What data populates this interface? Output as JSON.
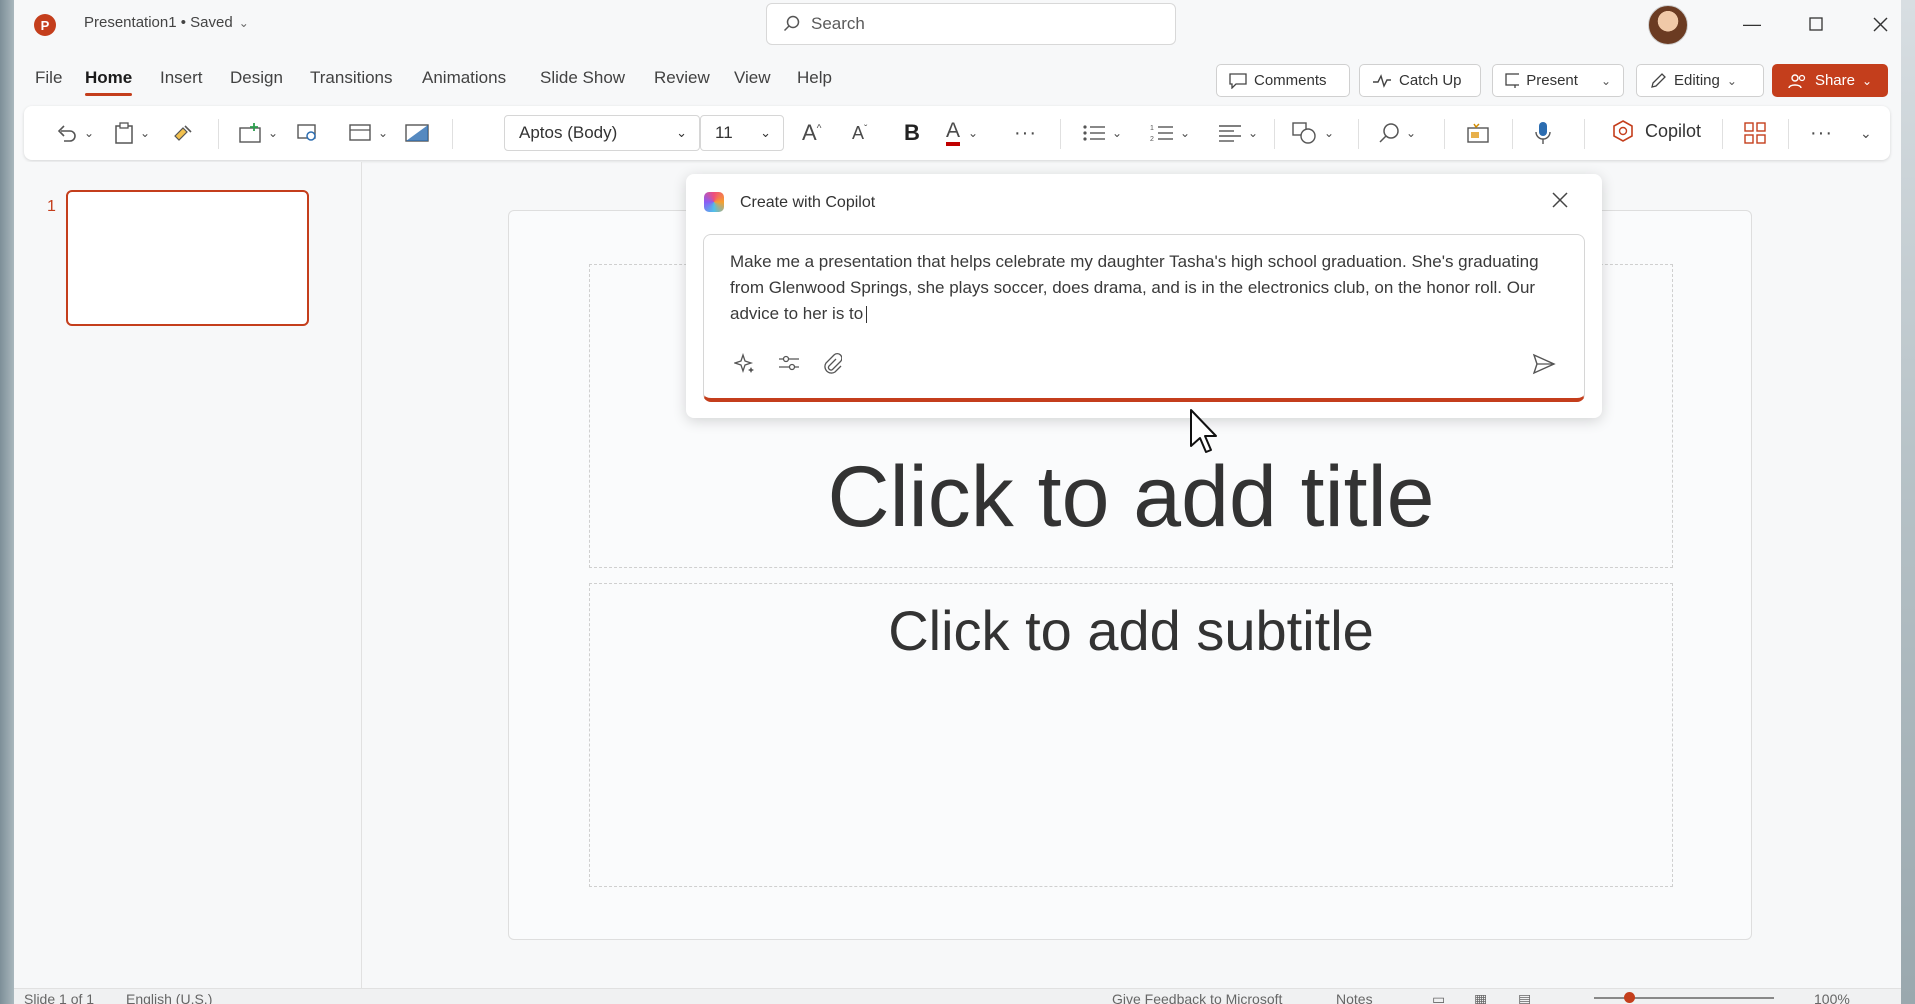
{
  "titlebar": {
    "app_icon": "P",
    "doc_title": "Presentation1 • Saved",
    "search_placeholder": "Search"
  },
  "menu": {
    "tabs": [
      "File",
      "Home",
      "Insert",
      "Design",
      "Transitions",
      "Animations",
      "Slide Show",
      "Review",
      "View",
      "Help"
    ],
    "active_tab": "Home",
    "comments": "Comments",
    "catch_up": "Catch Up",
    "present": "Present",
    "editing": "Editing",
    "share": "Share"
  },
  "ribbon": {
    "font_name": "Aptos (Body)",
    "font_size": "11",
    "bold": "B",
    "copilot_label": "Copilot",
    "more": "···"
  },
  "thumbnails": {
    "slide_number": "1"
  },
  "slide": {
    "title_placeholder": "Click to add title",
    "subtitle_placeholder": "Click to add subtitle"
  },
  "copilot_dialog": {
    "title": "Create with Copilot",
    "prompt": "Make me a presentation that helps celebrate my daughter Tasha's high school graduation. She's graduating from Glenwood Springs, she plays soccer, does drama, and is in the electronics club, on the honor roll. Our advice to her is to"
  },
  "statusbar": {
    "slide_info": "Slide 1 of 1",
    "language": "English (U.S.)",
    "feedback": "Give Feedback to Microsoft",
    "notes": "Notes",
    "zoom": "100%"
  },
  "colors": {
    "accent": "#c43e1c"
  }
}
